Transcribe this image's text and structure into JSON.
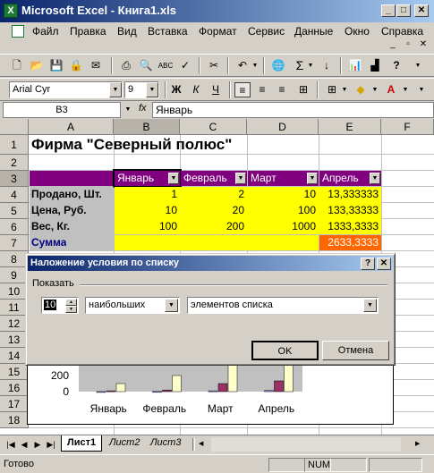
{
  "window": {
    "title": "Microsoft Excel - Книга1.xls",
    "app_icon_letter": "X"
  },
  "menu": [
    "Файл",
    "Правка",
    "Вид",
    "Вставка",
    "Формат",
    "Сервис",
    "Данные",
    "Окно",
    "Справка"
  ],
  "toolbar": {
    "font_name": "Arial Cyr",
    "font_size": "9",
    "bold": "Ж",
    "italic": "К",
    "underline": "Ч",
    "sum_symbol": "Σ",
    "help_symbol": "?"
  },
  "formula_bar": {
    "cell_ref": "B3",
    "fx": "fx",
    "content": "Январь"
  },
  "grid": {
    "columns": [
      "A",
      "B",
      "C",
      "D",
      "E",
      "F"
    ],
    "rows": [
      "1",
      "2",
      "3",
      "4",
      "5",
      "6",
      "7",
      "8",
      "9",
      "10",
      "11",
      "12",
      "13",
      "14",
      "15",
      "16",
      "17",
      "18"
    ],
    "title": "Фирма \"Северный полюс\"",
    "header_row": [
      "Январь",
      "Февраль",
      "Март",
      "Апрель"
    ],
    "row_labels": [
      "Продано, Шт.",
      "Цена, Руб.",
      "Вес, Кг."
    ],
    "data": [
      [
        "1",
        "2",
        "10",
        "13,333333"
      ],
      [
        "10",
        "20",
        "100",
        "133,33333"
      ],
      [
        "100",
        "200",
        "1000",
        "1333,3333"
      ]
    ],
    "sum_label": "Сумма",
    "sum_value": "2633,3333"
  },
  "chart_data": {
    "type": "bar",
    "categories": [
      "Январь",
      "Февраль",
      "Март",
      "Апрель"
    ],
    "series": [
      {
        "values": [
          1,
          2,
          10,
          13.333333
        ]
      },
      {
        "values": [
          10,
          20,
          100,
          133.33333
        ]
      },
      {
        "values": [
          100,
          200,
          1000,
          1333.3333
        ]
      }
    ],
    "ytick_labels": [
      "0",
      "200"
    ],
    "colors": [
      "#9999ff",
      "#993366",
      "#ffffcc"
    ]
  },
  "dialog": {
    "title": "Наложение условия по списку",
    "help_btn": "?",
    "close_btn": "✕",
    "group_label": "Показать",
    "count_value": "10",
    "which_value": "наибольших",
    "of_value": "элементов списка",
    "ok": "OK",
    "cancel": "Отмена"
  },
  "sheets": [
    "Лист1",
    "Лист2",
    "Лист3"
  ],
  "status": {
    "ready": "Готово",
    "num": "NUM"
  },
  "colors": {
    "header_purple": "#800080",
    "data_yellow": "#ffff00",
    "sum_orange": "#ff6600",
    "sum_text_blue": "#000080"
  }
}
